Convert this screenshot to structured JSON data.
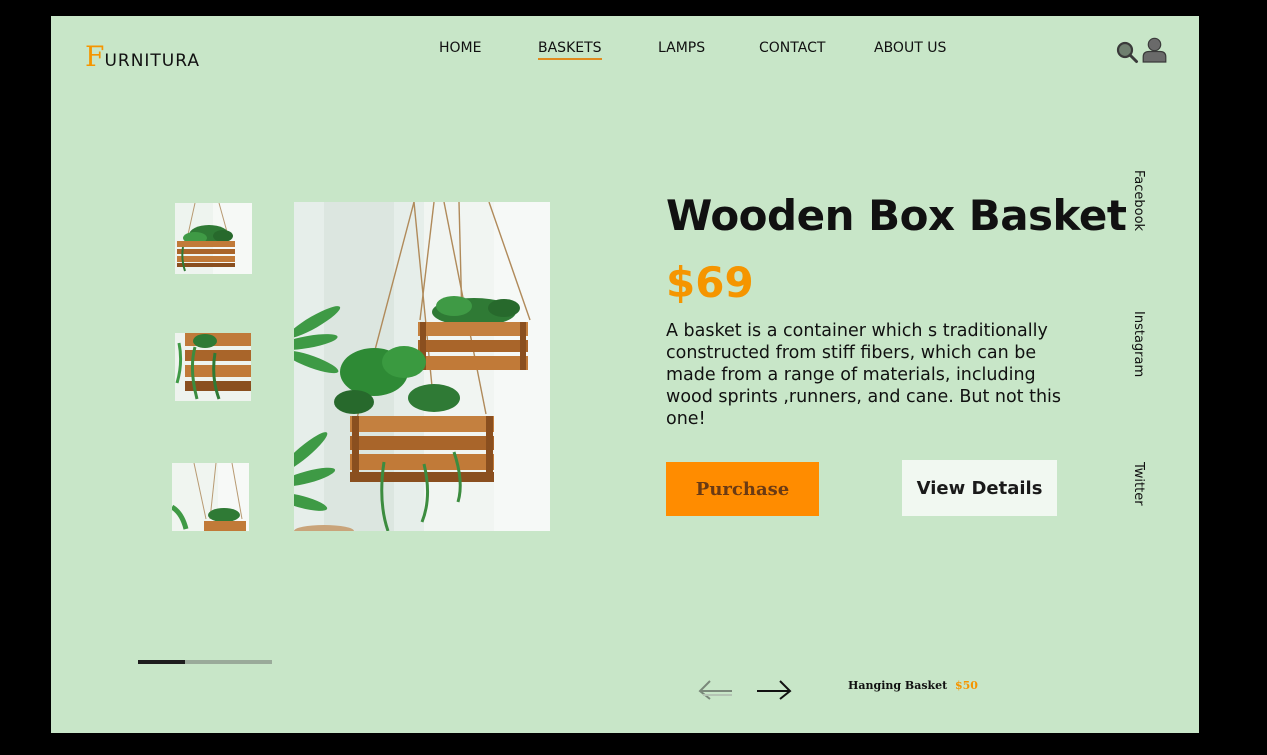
{
  "brand": {
    "initial": "F",
    "rest": "URNITURA",
    "accent_color": "#f59500"
  },
  "nav": {
    "items": [
      {
        "label": "HOME"
      },
      {
        "label": "BASKETS",
        "active": true
      },
      {
        "label": "LAMPS"
      },
      {
        "label": "CONTACT"
      },
      {
        "label": "ABOUT US"
      }
    ]
  },
  "header_icons": [
    "search-icon",
    "user-icon"
  ],
  "product": {
    "title": "Wooden Box Basket",
    "price": "$69",
    "description": "A basket is a container which s traditionally constructed from stiff fibers, which can be made from a range of materials, including wood sprints ,runners, and cane. But not this one!",
    "purchase_label": "Purchase",
    "details_label": "View Details"
  },
  "gallery": {
    "thumbnail_count": 3
  },
  "social": [
    "Facebook",
    "Instagram",
    "Twitter"
  ],
  "slider": {
    "progress": 0.35
  },
  "next_product": {
    "name": "Hanging Basket",
    "price": "$50"
  },
  "colors": {
    "background": "#c8e6c8",
    "accent": "#ff8c00",
    "details_button": "#f1f8f1"
  }
}
